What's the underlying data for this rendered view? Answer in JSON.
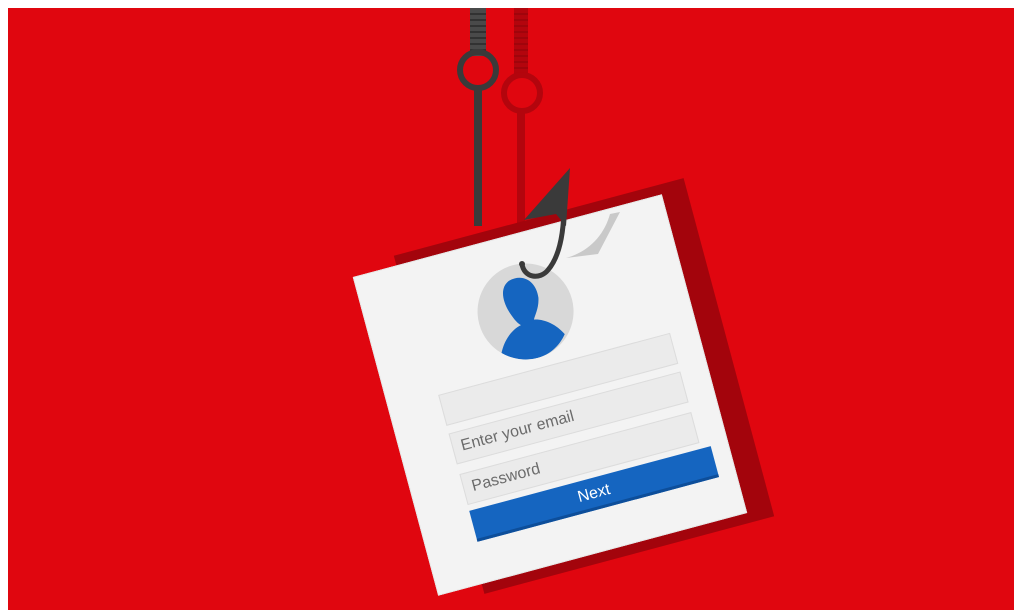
{
  "form": {
    "email_placeholder": "Enter your email",
    "password_placeholder": "Password",
    "next_label": "Next"
  },
  "colors": {
    "background": "#e0060f",
    "shadow": "#a3040c",
    "card": "#f3f3f3",
    "accent": "#1565c0",
    "hook": "#3a3a3a"
  },
  "icons": [
    "fishing-hook-icon",
    "user-silhouette-icon"
  ]
}
